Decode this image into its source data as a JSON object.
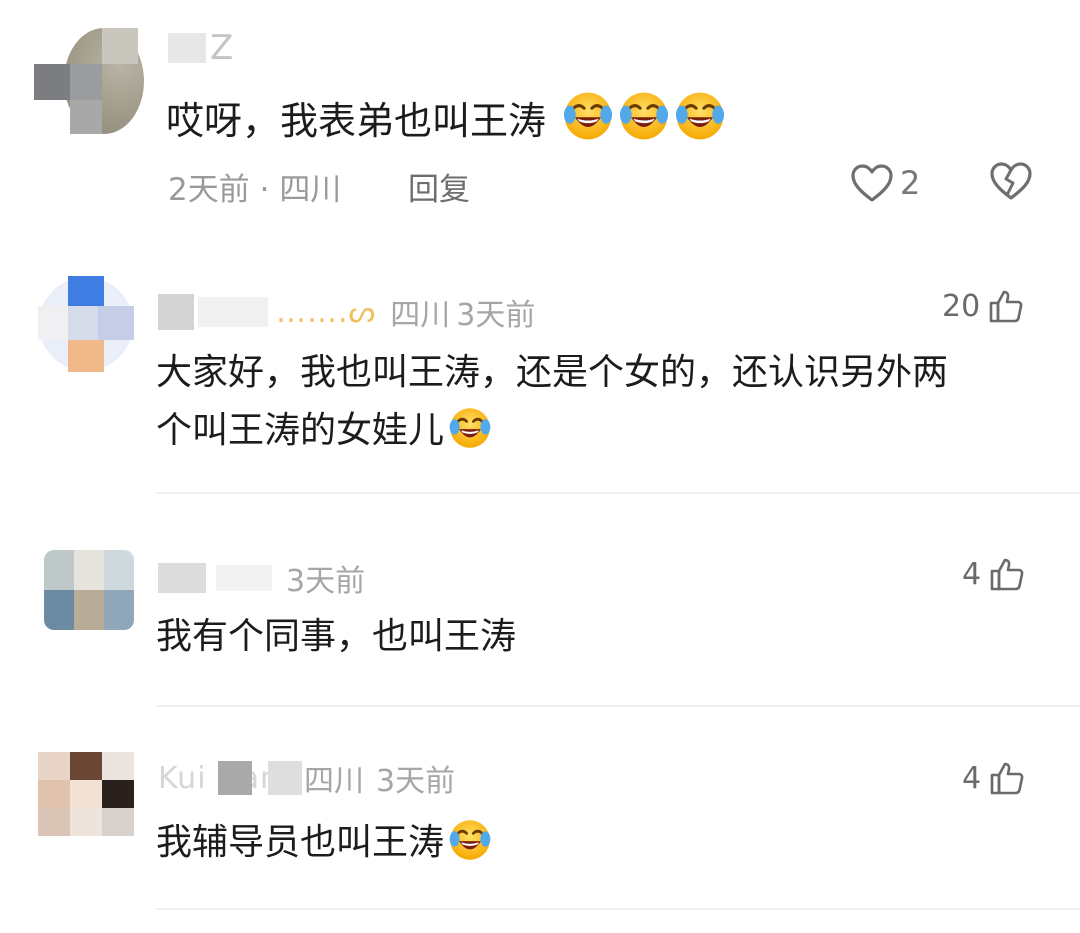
{
  "comments": [
    {
      "name_partial": "Z",
      "text": "哎呀，我表弟也叫王涛",
      "emoji_count": 3,
      "emoji_icon": "laughing-crying-face",
      "time": "2天前",
      "separator": "·",
      "location": "四川",
      "reply_label": "回复",
      "likes": "2"
    },
    {
      "name_partial": "…….ᔕ",
      "location": "四川",
      "time": "3天前",
      "likes": "20",
      "text_line1": "大家好，我也叫王涛，还是个女的，还认识另外两",
      "text_line2": "个叫王涛的女娃儿",
      "emoji_icon": "laughing-crying-face"
    },
    {
      "name_partial": "",
      "time": "3天前",
      "likes": "4",
      "text": "我有个同事，也叫王涛"
    },
    {
      "name_partial": "Kui Han",
      "location": "四川",
      "time": "3天前",
      "likes": "4",
      "text": "我辅导员也叫王涛",
      "emoji_icon": "laughing-crying-face"
    }
  ],
  "icons": {
    "like": "heart-outline-icon",
    "dislike": "broken-heart-icon",
    "thumb": "thumbs-up-icon"
  },
  "colors": {
    "text": "#1c1c1c",
    "meta": "#a6a6a6",
    "divider": "#efefef"
  }
}
